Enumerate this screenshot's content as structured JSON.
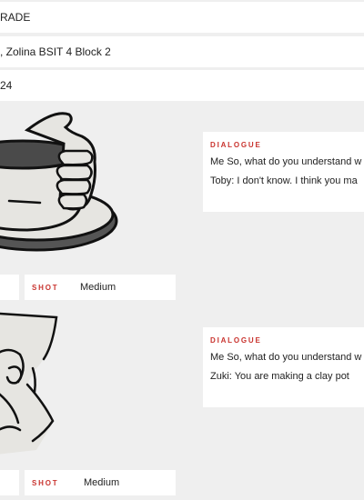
{
  "fields": {
    "grade": "RADE",
    "names": ", Zolina BSIT 4 Block 2",
    "date": "24"
  },
  "panels": [
    {
      "dialogue_label": "DIALOGUE",
      "lines": [
        "Me So, what do you understand w",
        "Toby: I don't know. I think you ma"
      ],
      "shot_label": "SHOT",
      "shot_value": "Medium"
    },
    {
      "dialogue_label": "DIALOGUE",
      "lines": [
        "Me So, what do you understand w",
        "Zuki: You are making a clay pot"
      ],
      "shot_label": "SHOT",
      "shot_value": "Medium"
    }
  ]
}
